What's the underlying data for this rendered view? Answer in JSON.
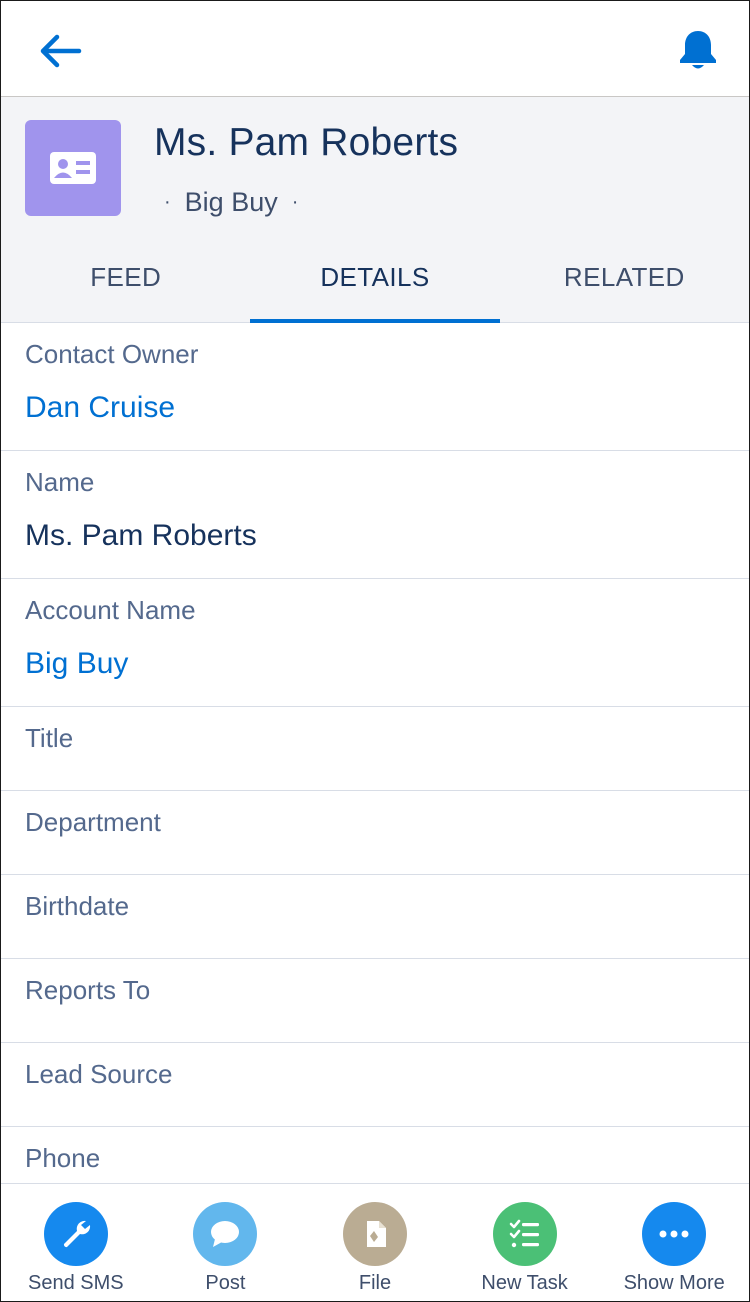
{
  "nav": {
    "back_icon": "arrow-left-icon",
    "notifications_icon": "bell-icon"
  },
  "header": {
    "icon": "contact-card-icon",
    "title": "Ms. Pam Roberts",
    "subtitle": "Big Buy",
    "subtitle_separator": "·"
  },
  "tabs": [
    {
      "label": "FEED",
      "active": false
    },
    {
      "label": "DETAILS",
      "active": true
    },
    {
      "label": "RELATED",
      "active": false
    }
  ],
  "fields": {
    "contact_owner": {
      "label": "Contact Owner",
      "value": "Dan Cruise"
    },
    "name": {
      "label": "Name",
      "value": "Ms. Pam Roberts"
    },
    "account_name": {
      "label": "Account Name",
      "value": "Big Buy"
    },
    "title": {
      "label": "Title",
      "value": ""
    },
    "department": {
      "label": "Department",
      "value": ""
    },
    "birthdate": {
      "label": "Birthdate",
      "value": ""
    },
    "reports_to": {
      "label": "Reports To",
      "value": ""
    },
    "lead_source": {
      "label": "Lead Source",
      "value": ""
    },
    "phone": {
      "label": "Phone",
      "value": ""
    }
  },
  "actions": [
    {
      "label": "Send SMS",
      "icon": "wrench-icon",
      "color": "#1589ee"
    },
    {
      "label": "Post",
      "icon": "chat-bubble-icon",
      "color": "#62b7ed"
    },
    {
      "label": "File",
      "icon": "file-icon",
      "color": "#baac93"
    },
    {
      "label": "New Task",
      "icon": "task-list-icon",
      "color": "#4bc076"
    },
    {
      "label": "Show More",
      "icon": "more-dots-icon",
      "color": "#1589ee"
    }
  ],
  "colors": {
    "link": "#0070d2",
    "accent": "#0070d2",
    "header_bg": "#f3f4f7",
    "record_icon_bg": "#a094ed"
  }
}
